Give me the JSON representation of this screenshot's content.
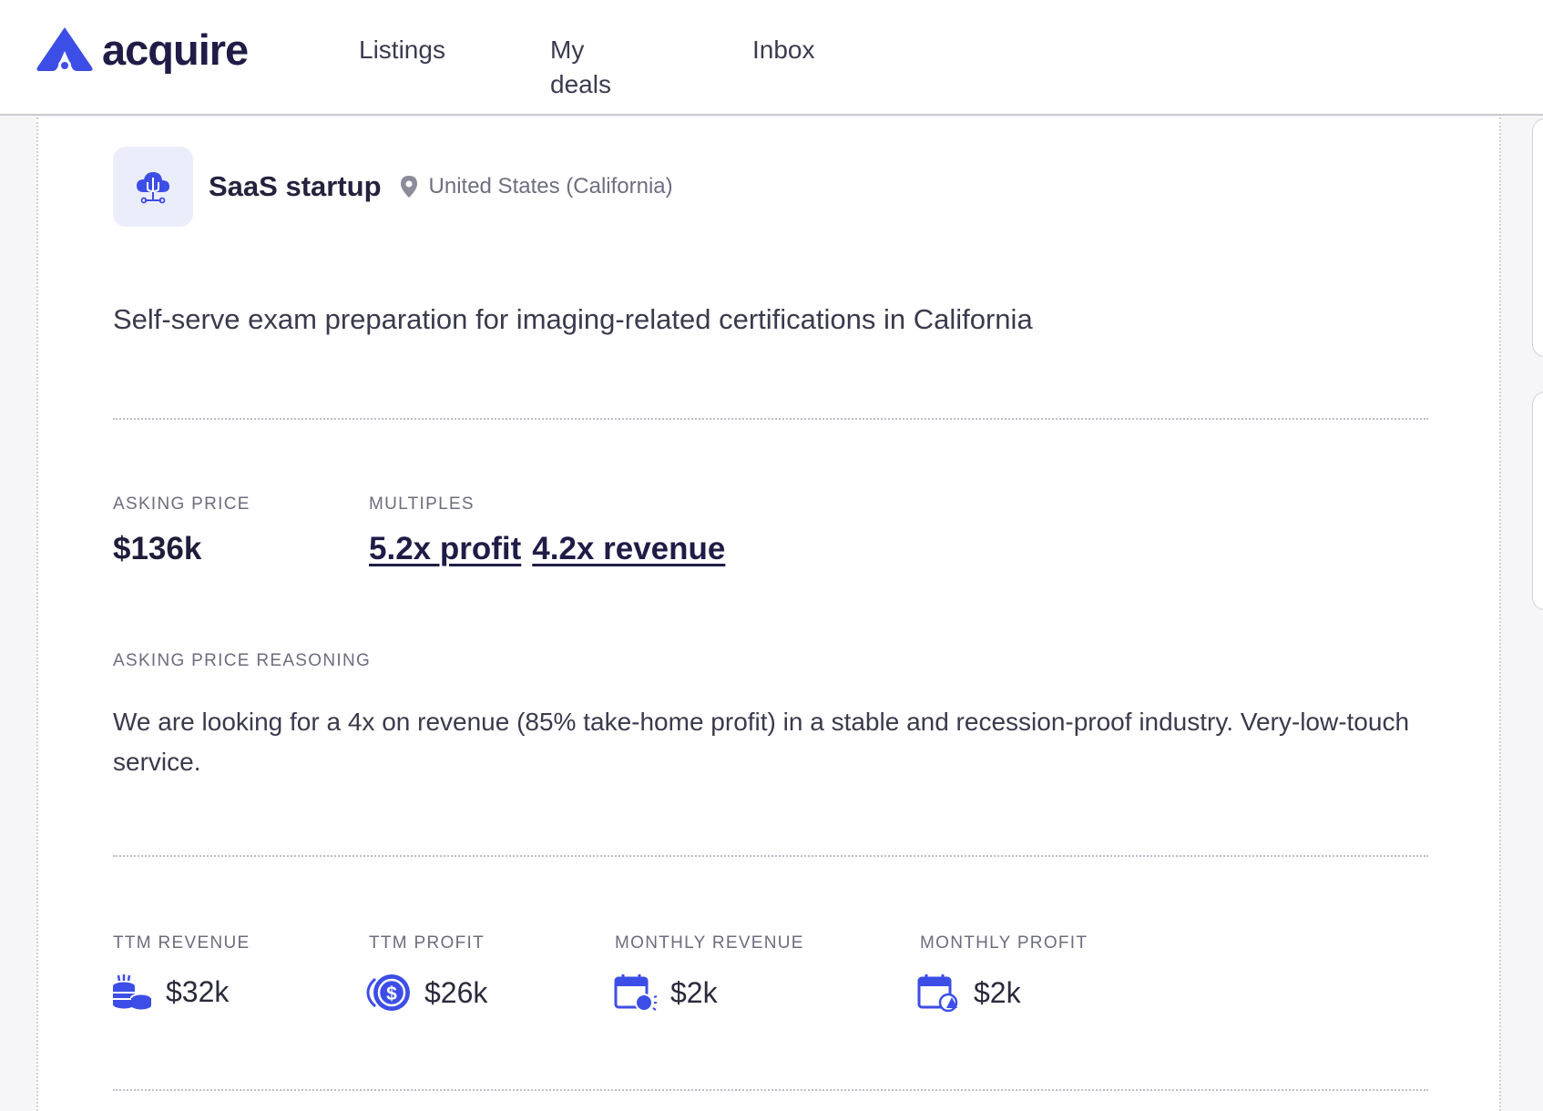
{
  "brand": {
    "name": "acquire",
    "accent": "#3d4ee6",
    "dark": "#1f1d47"
  },
  "nav": {
    "items": [
      "Listings",
      "My deals",
      "Inbox"
    ]
  },
  "listing": {
    "category": "SaaS startup",
    "location": "United States (California)",
    "tagline": "Self-serve exam preparation for imaging-related certifications in California",
    "asking_price_label": "ASKING PRICE",
    "asking_price": "$136k",
    "multiples_label": "MULTIPLES",
    "multiples": [
      "5.2x profit",
      "4.2x revenue"
    ],
    "reasoning_label": "ASKING PRICE REASONING",
    "reasoning": "We are looking for a 4x on revenue (85% take-home profit) in a stable and recession-proof industry. Very-low-touch service."
  },
  "metrics": [
    {
      "label": "TTM REVENUE",
      "value": "$32k",
      "icon": "coins-stack-icon"
    },
    {
      "label": "TTM PROFIT",
      "value": "$26k",
      "icon": "dollar-coin-icon"
    },
    {
      "label": "MONTHLY REVENUE",
      "value": "$2k",
      "icon": "calendar-coin-icon"
    },
    {
      "label": "MONTHLY PROFIT",
      "value": "$2k",
      "icon": "calendar-drop-icon"
    }
  ]
}
